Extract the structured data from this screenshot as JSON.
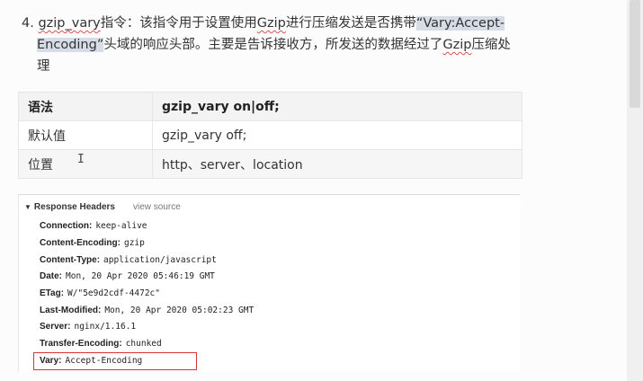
{
  "paragraph": {
    "number": "4.",
    "directive": "gzip_vary",
    "text_a": "指令：该指令用于设置使用",
    "gzip1": "Gzip",
    "text_b": "进行压缩发送是否携带",
    "highlight_1": "“Vary:Accept-",
    "highlight_2": "Encoding”",
    "text_c": "头域的响应头部。主要是告诉接收方，所发送的数据经过了",
    "gzip2": "Gzip",
    "text_d": "压缩处",
    "text_e": "理"
  },
  "table": {
    "rows": [
      {
        "label": "语法",
        "value": "gzip_vary on|off;"
      },
      {
        "label": "默认值",
        "value": "gzip_vary off;"
      },
      {
        "label": "位置",
        "value": "http、server、location"
      }
    ]
  },
  "cursor_glyph": "I",
  "devtools": {
    "section_title": "Response Headers",
    "view_source": "view source",
    "headers": [
      {
        "key": "Connection:",
        "value": "keep-alive"
      },
      {
        "key": "Content-Encoding:",
        "value": "gzip"
      },
      {
        "key": "Content-Type:",
        "value": "application/javascript"
      },
      {
        "key": "Date:",
        "value": "Mon, 20 Apr 2020 05:46:19 GMT"
      },
      {
        "key": "ETag:",
        "value": "W/\"5e9d2cdf-4472c\""
      },
      {
        "key": "Last-Modified:",
        "value": "Mon, 20 Apr 2020 05:02:23 GMT"
      },
      {
        "key": "Server:",
        "value": "nginx/1.16.1"
      },
      {
        "key": "Transfer-Encoding:",
        "value": "chunked"
      },
      {
        "key": "Vary:",
        "value": "Accept-Encoding"
      }
    ]
  },
  "colors": {
    "highlight": "#d6dde6",
    "annotation_box": "#dd3333",
    "spellcheck": "#d9534f"
  }
}
